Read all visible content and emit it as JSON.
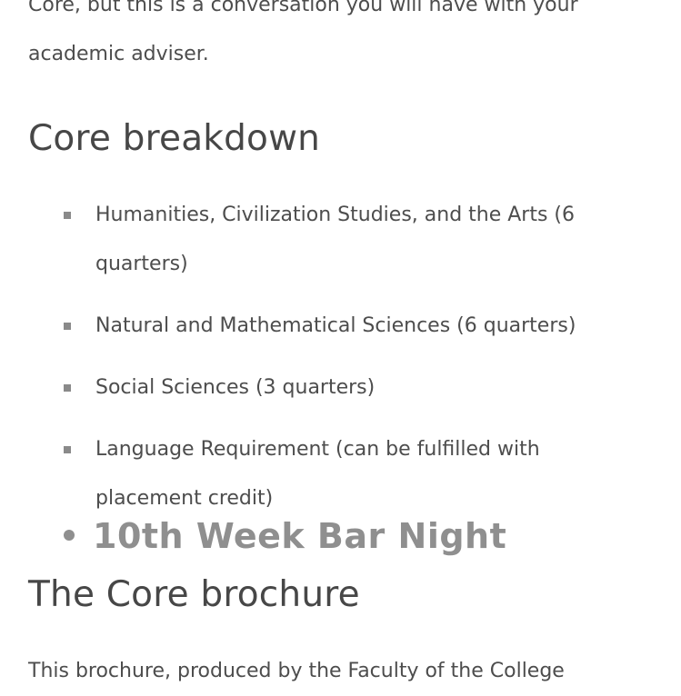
{
  "intro": {
    "line1": "Core, but this is a conversation you will have with your",
    "line2": "academic adviser."
  },
  "core_section": {
    "heading": "Core breakdown",
    "items": [
      {
        "label": "Humanities, Civilization Studies, and the Arts (6 quarters)"
      },
      {
        "label": "Natural and Mathematical Sciences (6 quarters)"
      },
      {
        "label": "Social Sciences (3 quarters)"
      },
      {
        "label": "Language Requirement (can be fulfilled with placement credit)"
      }
    ]
  },
  "overlay": {
    "text": "10th Week Bar Night"
  },
  "brochure_section": {
    "heading": "The Core brochure",
    "text": "This brochure, produced by the Faculty of the College"
  }
}
